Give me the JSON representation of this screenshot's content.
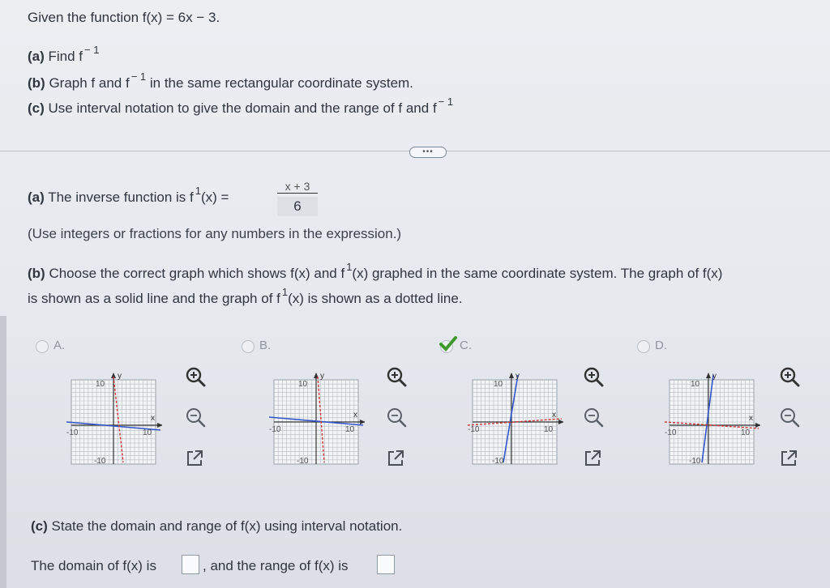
{
  "question": {
    "intro": "Given the function f(x) = 6x − 3.",
    "part_a_label": "(a)",
    "part_a_text": "Find f",
    "part_b_label": "(b)",
    "part_b_text1": "Graph f and f",
    "part_b_text2": "in the same rectangular coordinate system.",
    "part_c_label": "(c)",
    "part_c_text": "Use interval notation to give the domain and the range of f and f",
    "exponent": "− 1",
    "exponent_short": "1"
  },
  "more_button": "•••",
  "answer_a": {
    "label": "(a)",
    "text": "The inverse function is f",
    "after": "(x) =",
    "numerator": "x + 3",
    "denominator": "6",
    "hint": "(Use integers or fractions for any numbers in the expression.)"
  },
  "answer_b": {
    "label": "(b)",
    "text1": "Choose the correct graph which shows f(x) and f",
    "text2": "(x) graphed in the same coordinate system. The graph of f(x)",
    "text3": "is shown as a solid line and the graph of f",
    "text4": "(x) is shown as a dotted line."
  },
  "options": [
    {
      "label": "A.",
      "selected": false
    },
    {
      "label": "B.",
      "selected": false
    },
    {
      "label": "C.",
      "selected": true
    },
    {
      "label": "D.",
      "selected": false
    }
  ],
  "axis": {
    "ylabel": "y",
    "xlabel": "x",
    "max": "10",
    "min": "-10"
  },
  "answer_c": {
    "label": "(c)",
    "text": "State the domain and range of f(x) using interval notation.",
    "domain_prefix": "The domain of f(x) is",
    "range_prefix": ", and the range of f(x) is"
  },
  "colors": {
    "solid": "#3355cc",
    "dotted": "#d23838",
    "check": "#3f9a2e"
  }
}
